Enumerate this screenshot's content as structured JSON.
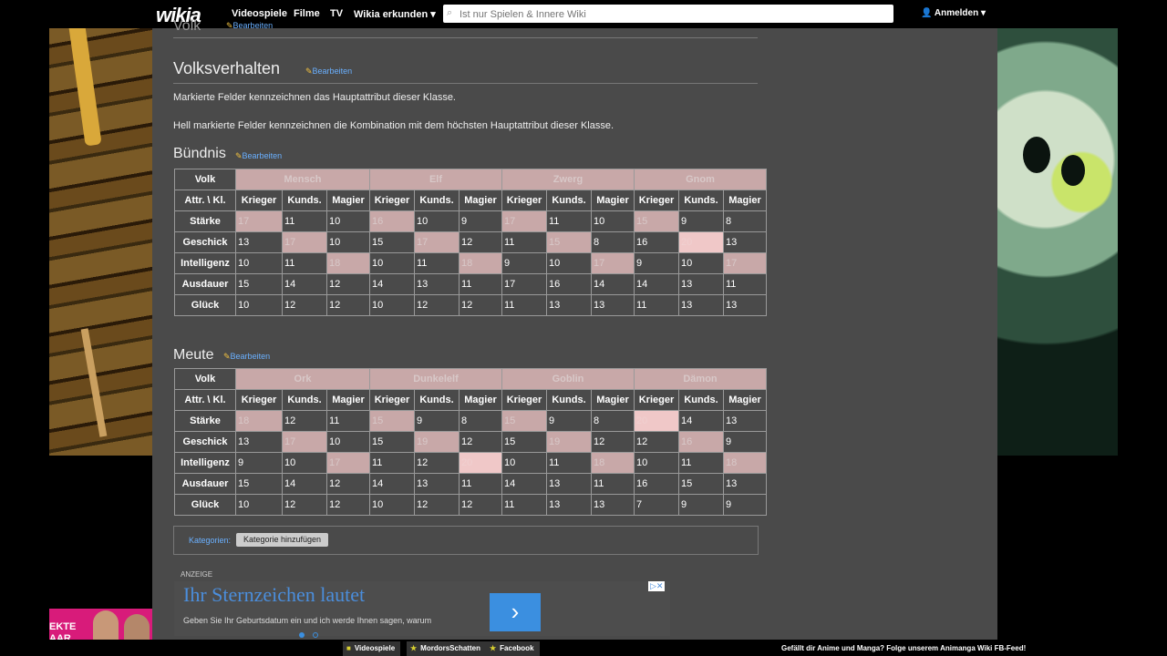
{
  "nav": {
    "logo": "wikia",
    "links": [
      "Videospiele",
      "Filme",
      "TV",
      "Wikia erkunden ▾"
    ],
    "search_placeholder": "Ist nur Spielen & Innere Wiki",
    "login": "Anmelden ▾"
  },
  "article": {
    "prev_heading": "Volk",
    "edit_label": "Bearbeiten",
    "section_title": "Volksverhalten",
    "para1": "Markierte Felder kennzeichnen das Hauptattribut dieser Klasse.",
    "para2": "Hell markierte Felder kennzeichnen die Kombination mit dem höchsten Hauptattribut dieser Klasse.",
    "buendnis_title": "Bündnis",
    "meute_title": "Meute",
    "col_volk": "Volk",
    "col_attr": "Attr. \\ Kl.",
    "classes": [
      "Krieger",
      "Kunds.",
      "Magier"
    ],
    "attributes": [
      "Stärke",
      "Geschick",
      "Intelligenz",
      "Ausdauer",
      "Glück"
    ],
    "buendnis": {
      "races": [
        "Mensch",
        "Elf",
        "Zwerg",
        "Gnom"
      ],
      "rows": [
        [
          "17",
          "11",
          "10",
          "16",
          "10",
          "9",
          "17",
          "11",
          "10",
          "15",
          "9",
          "8"
        ],
        [
          "13",
          "17",
          "10",
          "15",
          "17",
          "12",
          "11",
          "15",
          "8",
          "16",
          "20",
          "13"
        ],
        [
          "10",
          "11",
          "18",
          "10",
          "11",
          "18",
          "9",
          "10",
          "17",
          "9",
          "10",
          "17"
        ],
        [
          "15",
          "14",
          "12",
          "14",
          "13",
          "11",
          "17",
          "16",
          "14",
          "14",
          "13",
          "11"
        ],
        [
          "10",
          "12",
          "12",
          "10",
          "12",
          "12",
          "11",
          "13",
          "13",
          "11",
          "13",
          "13"
        ]
      ]
    },
    "meute": {
      "races": [
        "Ork",
        "Dunkelelf",
        "Goblin",
        "Dämon"
      ],
      "rows": [
        [
          "18",
          "12",
          "11",
          "15",
          "9",
          "8",
          "15",
          "9",
          "8",
          "20",
          "14",
          "13"
        ],
        [
          "13",
          "17",
          "10",
          "15",
          "19",
          "12",
          "15",
          "19",
          "12",
          "12",
          "16",
          "9"
        ],
        [
          "9",
          "10",
          "17",
          "11",
          "12",
          "20",
          "10",
          "11",
          "18",
          "10",
          "11",
          "18"
        ],
        [
          "15",
          "14",
          "12",
          "14",
          "13",
          "11",
          "14",
          "13",
          "11",
          "16",
          "15",
          "13"
        ],
        [
          "10",
          "12",
          "12",
          "10",
          "12",
          "12",
          "11",
          "13",
          "13",
          "7",
          "9",
          "9"
        ]
      ]
    },
    "categories_label": "Kategorien:",
    "add_category": "Kategorie hinzufügen",
    "ad_label": "ANZEIGE",
    "ad_title": "Ihr Sternzeichen lautet",
    "ad_sub": "Geben Sie Ihr Geburtsdatum ein und ich werde Ihnen sagen, warum",
    "ad_go": "›",
    "ad_x": "▷✕"
  },
  "promo_text": "EKTE\nAAR",
  "bottom": {
    "items": [
      "Videospiele",
      "MordorsSchatten",
      "Facebook"
    ],
    "note": "Gefällt dir Anime und Manga? Folge unserem Animanga Wiki FB-Feed!"
  },
  "colors": {
    "highlight": "#c8a8a8",
    "bright_highlight": "#f0c8c8",
    "link": "#6ab0ff"
  }
}
